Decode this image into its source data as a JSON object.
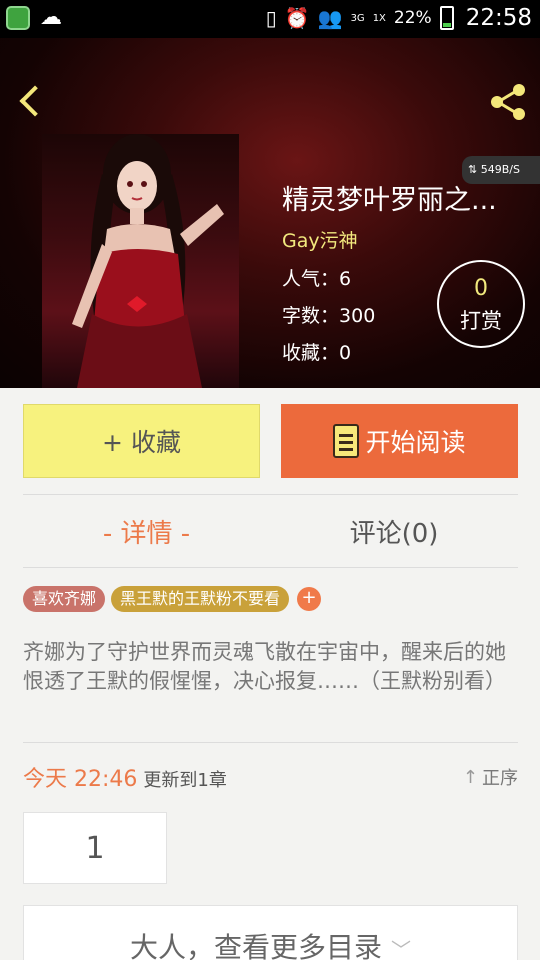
{
  "status_bar": {
    "network": "3G",
    "network_sub": "1X",
    "battery": "22%",
    "time": "22:58",
    "net_speed": "549B/S"
  },
  "book": {
    "title": "精灵梦叶罗丽之...",
    "author": "Gay污神",
    "stats": [
      {
        "label": "人气：",
        "value": "6"
      },
      {
        "label": "字数：",
        "value": "300"
      },
      {
        "label": "收藏：",
        "value": "0"
      }
    ],
    "tip_count": "0",
    "tip_label": "打赏"
  },
  "actions": {
    "collect": "+ 收藏",
    "read": "开始阅读"
  },
  "tabs": {
    "detail": "- 详情 -",
    "comment": "评论(0)"
  },
  "tags": [
    "喜欢齐娜",
    "黑王默的王默粉不要看"
  ],
  "tag_add": "+",
  "description": "齐娜为了守护世界而灵魂飞散在宇宙中，醒来后的她恨透了王默的假惺惺，决心报复……（王默粉别看）",
  "update": {
    "time": "今天 22:46",
    "text": "更新到1章",
    "sort_label": "正序"
  },
  "chapter_number": "1",
  "more_catalog": "大人，查看更多目录",
  "colors": {
    "accent_orange": "#ec6a3c",
    "collect_yellow": "#f7f27e",
    "author_yellow": "#f2e97e"
  },
  "icons": [
    "back-icon",
    "share-icon",
    "book-icon",
    "sort-arrow-icon",
    "chevron-down-icon"
  ]
}
